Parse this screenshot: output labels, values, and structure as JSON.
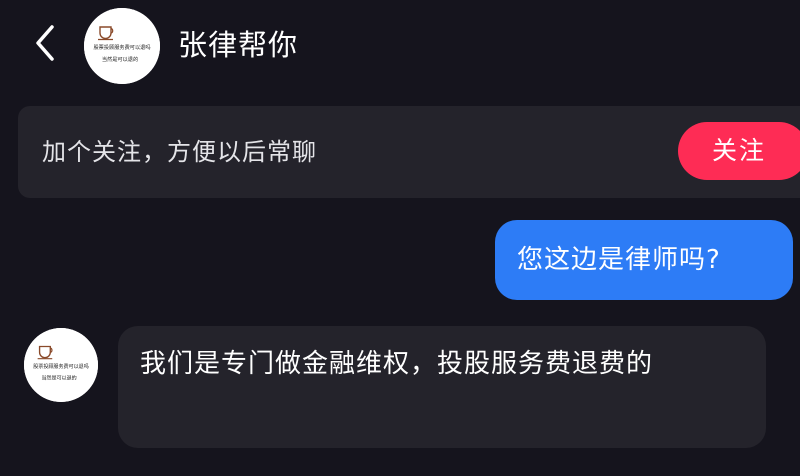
{
  "header": {
    "title": "张律帮你",
    "back_icon": "chevron-left-icon",
    "avatar": {
      "icon": "coffee-cup-icon",
      "line1": "股票投顾服务费可以退吗",
      "line2": "当然是可以退的"
    }
  },
  "follow_banner": {
    "text": "加个关注，方便以后常聊",
    "button_label": "关注",
    "button_color": "#fe2c55"
  },
  "messages": [
    {
      "direction": "outgoing",
      "text": "您这边是律师吗?",
      "color": "#2d7cf6"
    },
    {
      "direction": "incoming",
      "text": "我们是专门做金融维权，投股服务费退费的",
      "avatar": {
        "icon": "coffee-cup-icon",
        "line1": "股票投顾服务费可以退吗",
        "line2": "当然是可以退的"
      }
    }
  ],
  "colors": {
    "background": "#15141d",
    "card": "#24232b"
  }
}
